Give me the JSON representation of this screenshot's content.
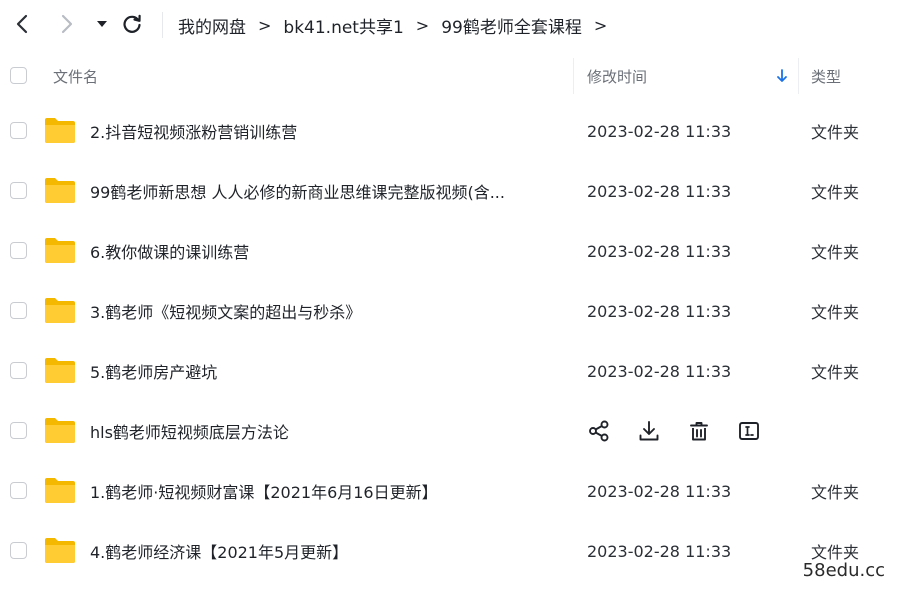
{
  "nav": {
    "back_icon": "chevron-left-icon",
    "forward_icon": "chevron-right-icon",
    "dropdown_icon": "caret-down-icon",
    "refresh_icon": "refresh-icon"
  },
  "breadcrumb": {
    "items": [
      "我的网盘",
      "bk41.net共享1",
      "99鹤老师全套课程"
    ],
    "separator": ">"
  },
  "table": {
    "columns": {
      "name": "文件名",
      "modified": "修改时间",
      "type": "类型"
    },
    "sort_icon": "arrow-down-icon",
    "sort_color": "#1a73e8",
    "rows": [
      {
        "name": "2.抖音短视频涨粉营销训练营",
        "modified": "2023-02-28 11:33",
        "type": "文件夹"
      },
      {
        "name": "99鹤老师新思想 人人必修的新商业思维课完整版视频(含...",
        "modified": "2023-02-28 11:33",
        "type": "文件夹"
      },
      {
        "name": "6.教你做课的课训练营",
        "modified": "2023-02-28 11:33",
        "type": "文件夹"
      },
      {
        "name": "3.鹤老师《短视频文案的超出与秒杀》",
        "modified": "2023-02-28 11:33",
        "type": "文件夹"
      },
      {
        "name": "5.鹤老师房产避坑",
        "modified": "2023-02-28 11:33",
        "type": "文件夹"
      },
      {
        "name": "hls鹤老师短视频底层方法论",
        "modified": "",
        "type": "",
        "hovered": true
      },
      {
        "name": "1.鹤老师·短视频财富课【2021年6月16日更新】",
        "modified": "2023-02-28 11:33",
        "type": "文件夹"
      },
      {
        "name": "4.鹤老师经济课【2021年5月更新】",
        "modified": "2023-02-28 11:33",
        "type": "文件夹"
      }
    ],
    "hover_actions": [
      "share-icon",
      "download-icon",
      "delete-icon",
      "rename-icon"
    ]
  },
  "colors": {
    "folder": "#ffcc33",
    "folder_tab": "#f5b800"
  },
  "watermark": "58edu.cc"
}
